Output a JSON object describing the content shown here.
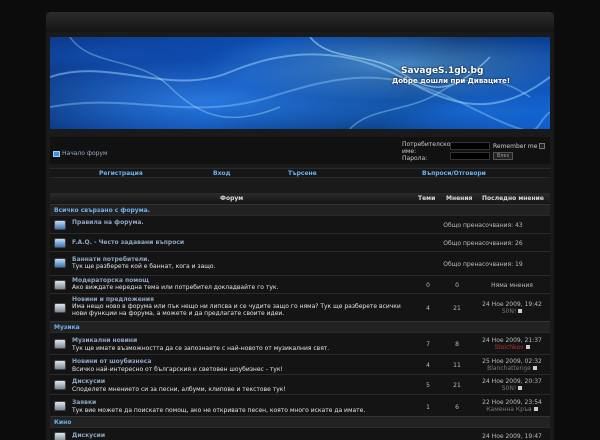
{
  "banner": {
    "site_title": "SavageS.1gb.bg",
    "site_subtitle": "Добре дошли при Диваците!"
  },
  "breadcrumb": {
    "home_label": "Начало форум"
  },
  "login": {
    "username_label": "Потребителско име:",
    "password_label": "Парола:",
    "remember_label": "Remember me",
    "login_button": "Влез"
  },
  "menu": {
    "items": [
      {
        "label": "Регистрация"
      },
      {
        "label": "Вход"
      },
      {
        "label": "Търсене"
      },
      {
        "label": "Въпроси/Отговори"
      }
    ]
  },
  "table": {
    "headers": {
      "forum": "Форум",
      "topics": "Теми",
      "posts": "Мнения",
      "last_post": "Последно мнение"
    },
    "categories": [
      {
        "name": "Всичко свързано с форума."
      },
      {
        "name": "Музика"
      },
      {
        "name": "Кино"
      }
    ],
    "rows": [
      {
        "title": "Правила на форума.",
        "desc": "",
        "span": "Общо пренасочвания: 43"
      },
      {
        "title": "F.A.Q. - Често задавани въпроси",
        "desc": "",
        "span": "Общо пренасочвания: 26"
      },
      {
        "title": "Баннати потребители.",
        "desc": "Тук ще разберете кой е баннат, кога и защо.",
        "span": "Общо пренасочвания: 19"
      },
      {
        "title": "Модераторска помощ",
        "desc": "Ако виждате нередна тема или потребител докладвайте го тук.",
        "topics": "0",
        "posts": "0",
        "last_date": "Няма мнения",
        "last_user": ""
      },
      {
        "title": "Новини и предложения",
        "desc": "Има нещо ново в форума или пък нещо ни липсва и се чудите защо го няма? Тук ще разберете всички нови функции на форума, а можете и да предлагате своите идеи.",
        "topics": "4",
        "posts": "21",
        "last_date": "24 Ное 2009, 19:42",
        "last_user": "S0N!"
      },
      {
        "title": "Музикални новини",
        "desc": "Тук ще имате възможността да се запознаете с най-новото от музикалния свят.",
        "topics": "7",
        "posts": "8",
        "last_date": "24 Ное 2009, 21:37",
        "last_user": "Stoichkov"
      },
      {
        "title": "Новини от шоубизнеса",
        "desc": "Всичко най-интересно от българския и световен шоубизнес - тук!",
        "topics": "4",
        "posts": "11",
        "last_date": "25 Ное 2009, 02:32",
        "last_user": "Blanchattenge"
      },
      {
        "title": "Дискусии",
        "desc": "Споделете мнението си за песни, албуми, клипове и текстове тук!",
        "topics": "5",
        "posts": "21",
        "last_date": "24 Ное 2009, 20:37",
        "last_user": "S0N!"
      },
      {
        "title": "Заявки",
        "desc": "Тук вие можете да поискате помощ, ако не откривате песен, която много искате да имате.",
        "topics": "1",
        "posts": "6",
        "last_date": "22 Ное 2009, 23:54",
        "last_user": "Каменна Кръв"
      },
      {
        "title": "Дискусии",
        "desc": "",
        "topics": "",
        "posts": "",
        "last_date": "24 Ное 2009, 19:47",
        "last_user": ""
      }
    ]
  }
}
